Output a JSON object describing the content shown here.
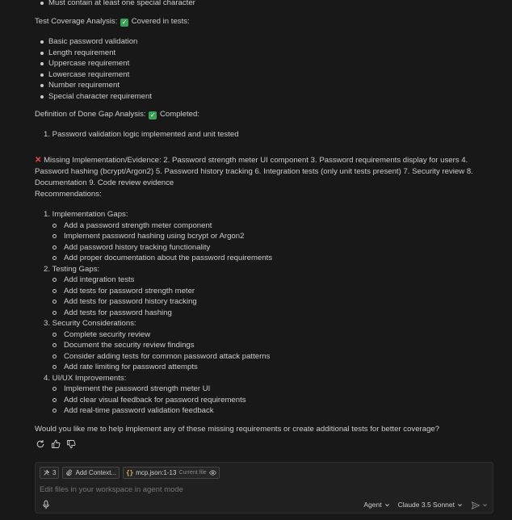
{
  "top_bullets": [
    "Must contain at least one special character"
  ],
  "coverage": {
    "heading": "Test Coverage Analysis:",
    "status": "Covered in tests:",
    "items": [
      "Basic password validation",
      "Length requirement",
      "Uppercase requirement",
      "Lowercase requirement",
      "Number requirement",
      "Special character requirement"
    ]
  },
  "dod": {
    "heading": "Definition of Done Gap Analysis:",
    "status": "Completed:",
    "completed_num": "1.",
    "completed_text": "Password validation logic implemented and unit tested",
    "check_glyph": "✓",
    "missing_glyph": "✕",
    "missing_text": "Missing Implementation/Evidence: 2. Password strength meter UI component 3. Password requirements display for users 4. Password hashing (bcrypt/Argon2) 5. Password history tracking 6. Integration tests (only unit tests present) 7. Security review 8. Documentation 9. Code review evidence"
  },
  "recommendations": {
    "heading": "Recommendations:",
    "sections": [
      {
        "num": "1.",
        "title": "Implementation Gaps:",
        "items": [
          "Add a password strength meter component",
          "Implement password hashing using bcrypt or Argon2",
          "Add password history tracking functionality",
          "Add proper documentation about the password requirements"
        ]
      },
      {
        "num": "2.",
        "title": "Testing Gaps:",
        "items": [
          "Add integration tests",
          "Add tests for password strength meter",
          "Add tests for password history tracking",
          "Add tests for password hashing"
        ]
      },
      {
        "num": "3.",
        "title": "Security Considerations:",
        "items": [
          "Complete security review",
          "Document the security review findings",
          "Consider adding tests for common password attack patterns",
          "Add rate limiting for password attempts"
        ]
      },
      {
        "num": "4.",
        "title": "UI/UX Improvements:",
        "items": [
          "Implement the password strength meter UI",
          "Add clear visual feedback for password requirements",
          "Add real-time password validation feedback"
        ]
      }
    ]
  },
  "closing": "Would you like me to help implement any of these missing requirements or create additional tests for better coverage?",
  "actions": [
    "retry-icon",
    "thumbs-up-icon",
    "thumbs-down-icon"
  ],
  "input": {
    "tools_count": "3",
    "add_context_label": "Add Context...",
    "file_chip_label": "mcp.json:1-13",
    "file_chip_desc": "Current file",
    "placeholder": "Edit files in your workspace in agent mode",
    "mode_label": "Agent",
    "model_label": "Claude 3.5 Sonnet"
  },
  "colors": {
    "background": "#181818",
    "text": "#cccccc",
    "check_badge": "#3ba255",
    "error_x": "#e5484d",
    "input_bg": "#202020"
  }
}
